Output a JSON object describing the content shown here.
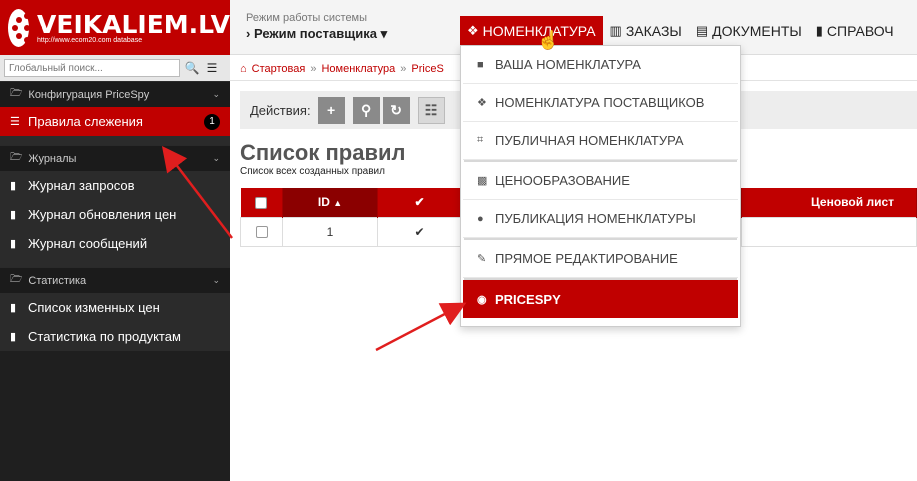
{
  "sidebar": {
    "logo_text": "VEIKALIEM.LV",
    "logo_sub": "http://www.ecom20.com database",
    "search_placeholder": "Глобальный поиск...",
    "groups": [
      {
        "label": "Конфигурация PriceSpy",
        "items": [
          {
            "label": "Правила слежения",
            "badge": "1",
            "active": true
          }
        ]
      },
      {
        "label": "Журналы",
        "items": [
          {
            "label": "Журнал запросов"
          },
          {
            "label": "Журнал обновления цен"
          },
          {
            "label": "Журнал сообщений"
          }
        ]
      },
      {
        "label": "Статистика",
        "items": [
          {
            "label": "Список изменных цен"
          },
          {
            "label": "Статистика по продуктам"
          }
        ]
      }
    ]
  },
  "topbar": {
    "mode_label": "Режим работы системы",
    "mode_value": "Режим поставщика",
    "nav": [
      {
        "label": "НОМЕНКЛАТУРА",
        "active": true,
        "icon": "cubes-icon"
      },
      {
        "label": "ЗАКАЗЫ",
        "icon": "basket-icon"
      },
      {
        "label": "ДОКУМЕНТЫ",
        "icon": "file-icon"
      },
      {
        "label": "СПРАВОЧ",
        "icon": "book-icon"
      }
    ]
  },
  "breadcrumb": [
    "Стартовая",
    "Номенклатура",
    "PriceS"
  ],
  "actions": {
    "label": "Действия:"
  },
  "page": {
    "title": "Список правил",
    "subtitle": "Список всех созданных правил"
  },
  "table": {
    "headers": [
      "ID",
      "Ценовой лист"
    ],
    "rows": [
      {
        "id": "1"
      }
    ]
  },
  "dropdown": {
    "items": [
      {
        "label": "ВАША НОМЕНКЛАТУРА",
        "icon": "cube-icon"
      },
      {
        "label": "НОМЕНКЛАТУРА ПОСТАВЩИКОВ",
        "icon": "cubes-icon"
      },
      {
        "label": "ПУБЛИЧНАЯ НОМЕНКЛАТУРА",
        "icon": "rss-icon"
      },
      {
        "label": "ЦЕНООБРАЗОВАНИЕ",
        "icon": "money-icon"
      },
      {
        "label": "ПУБЛИКАЦИЯ НОМЕНКЛАТУРЫ",
        "icon": "globe-icon"
      },
      {
        "label": "ПРЯМОЕ РЕДАКТИРОВАНИЕ",
        "icon": "edit-icon"
      },
      {
        "label": "PRICESPY",
        "icon": "eye-icon",
        "active": true
      }
    ]
  },
  "colors": {
    "brand": "#c00000",
    "sidebar_bg": "#1f1f1f",
    "sorted_header": "#8b0000"
  }
}
